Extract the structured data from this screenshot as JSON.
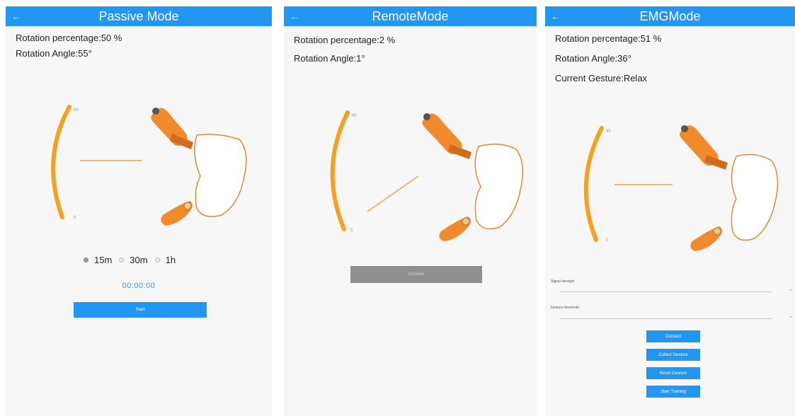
{
  "panels": {
    "passive": {
      "title": "Passive Mode",
      "back_icon": "back-arrow-icon",
      "rotation_percentage": "Rotation percentage:50 %",
      "rotation_angle": "Rotation Angle:55°",
      "radio_options": [
        "15m",
        "30m",
        "1h"
      ],
      "radio_selected": "15m",
      "timer": "00:00:00",
      "start_label": "Start"
    },
    "remote": {
      "title": "RemoteMode",
      "back_icon": "back-arrow-icon",
      "rotation_percentage": "Rotation percentage:2 %",
      "rotation_angle": "Rotation Angle:1°",
      "action_label": "Connect"
    },
    "emg": {
      "title": "EMGMode",
      "back_icon": "back-arrow-icon",
      "rotation_percentage": "Rotation percentage:51 %",
      "rotation_angle": "Rotation Angle:36°",
      "current_gesture": "Current Gesture:Relax",
      "slider1_label": "Signal strength",
      "slider2_label": "Gesture threshold",
      "buttons": [
        "Connect",
        "Collect Gesture",
        "Reset Gesture",
        "Start Training"
      ]
    }
  },
  "colors": {
    "header": "#2196f3",
    "arc": "#f7a01e",
    "finger": "#f08a2c",
    "button": "#2196f3",
    "disabled_button": "#8f8f8f"
  }
}
